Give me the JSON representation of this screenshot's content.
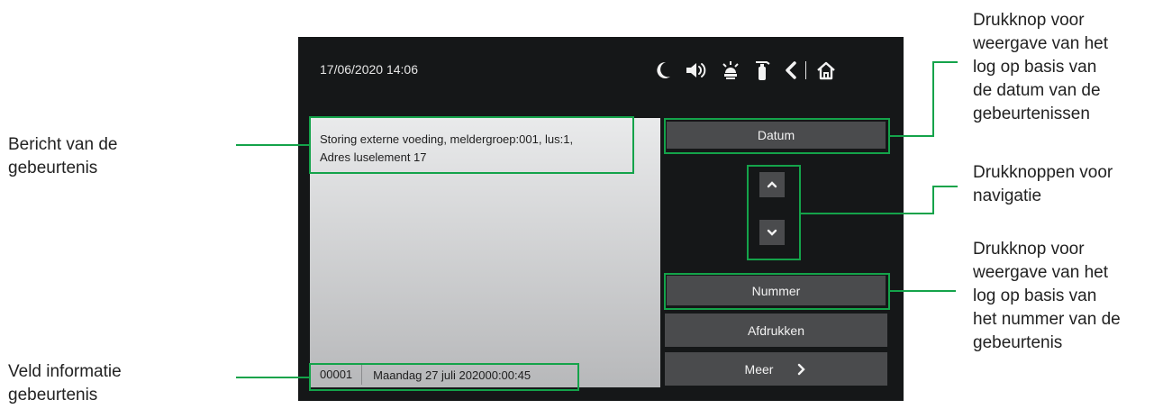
{
  "screen": {
    "datetime": "17/06/2020  14:06",
    "icons": [
      "moon-icon",
      "speaker-icon",
      "siren-icon",
      "fire-extinguisher-icon",
      "back-icon",
      "home-icon"
    ],
    "message_line1": "Storing externe voeding, meldergroep:001, lus:1,",
    "message_line2": "Adres luselement 17",
    "event_number": "00001",
    "event_date": "Maandag 27 juli 2020",
    "event_time": "00:00:45",
    "buttons": {
      "datum": "Datum",
      "nummer": "Nummer",
      "afdrukken": "Afdrukken",
      "meer": "Meer"
    }
  },
  "annotations": {
    "left_message": [
      "Bericht van de",
      "gebeurtenis"
    ],
    "left_info": [
      "Veld informatie",
      "gebeurtenis"
    ],
    "right_datum": [
      "Drukknop voor",
      "weergave van het",
      "log op basis van",
      "de datum van de",
      "gebeurtenissen"
    ],
    "right_nav": [
      "Drukknoppen voor",
      "navigatie"
    ],
    "right_nummer": [
      "Drukknop voor",
      "weergave van het",
      "log op basis van",
      "het nummer van de",
      "gebeurtenis"
    ]
  },
  "colors": {
    "screen_bg": "#151718",
    "button_bg": "#4a4b4d",
    "highlight": "#14a34a"
  }
}
